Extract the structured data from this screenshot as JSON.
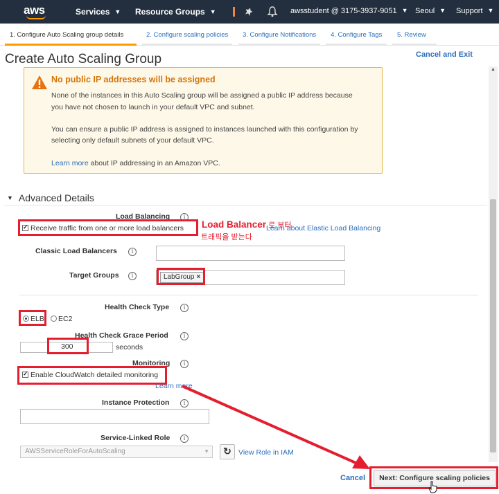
{
  "topnav": {
    "logo": "aws",
    "services": "Services",
    "resource_groups": "Resource Groups",
    "account": "awsstudent @ 3175-3937-9051",
    "region": "Seoul",
    "support": "Support",
    "icons": [
      "pin-icon",
      "bell-icon"
    ]
  },
  "steps": [
    {
      "label": "1. Configure Auto Scaling group details",
      "active": true
    },
    {
      "label": "2. Configure scaling policies",
      "active": false
    },
    {
      "label": "3. Configure Notifications",
      "active": false
    },
    {
      "label": "4. Configure Tags",
      "active": false
    },
    {
      "label": "5. Review",
      "active": false
    }
  ],
  "page": {
    "title": "Create Auto Scaling Group",
    "cancel_and_exit": "Cancel and Exit"
  },
  "warning": {
    "title": "No public IP addresses will be assigned",
    "para1_line1": "None of the instances in this Auto Scaling group will be assigned a public IP address because",
    "para1_line2": "you have not chosen to launch in your default VPC and subnet.",
    "para2_line1": "You can ensure a public IP address is assigned to instances launched with this configuration by",
    "para2_line2": "selecting only default subnets of your default VPC.",
    "learn_more": "Learn more",
    "learn_more_suffix": "about IP addressing in an Amazon VPC."
  },
  "advanced": {
    "section_title": "Advanced Details",
    "load_balancing": {
      "label": "Load Balancing",
      "checkbox_label": "Receive traffic from one or more load balancers",
      "checked": true,
      "learn_link": "Learn about Elastic Load Balancing"
    },
    "classic_lb": {
      "label": "Classic Load Balancers",
      "value": ""
    },
    "target_groups": {
      "label": "Target Groups",
      "tags": [
        "LabGroup"
      ],
      "remove_glyph": "×"
    },
    "health_check_type": {
      "label": "Health Check Type",
      "options": [
        "ELB",
        "EC2"
      ],
      "selected": "ELB"
    },
    "grace_period": {
      "label": "Health Check Grace Period",
      "value": "300",
      "unit": "seconds"
    },
    "monitoring": {
      "label": "Monitoring",
      "checkbox_label": "Enable CloudWatch detailed monitoring",
      "checked": true,
      "learn_more": "Learn more"
    },
    "instance_protection": {
      "label": "Instance Protection",
      "value": ""
    },
    "service_linked_role": {
      "label": "Service-Linked Role",
      "selected": "AWSServiceRoleForAutoScaling",
      "view_role": "View Role in IAM"
    }
  },
  "annotation": {
    "title": "Load Balancer",
    "title_suffix": " 로 부터",
    "subtitle": "트래픽을 받는다",
    "color": "#e41e2e"
  },
  "footer": {
    "cancel": "Cancel",
    "next": "Next: Configure scaling policies"
  },
  "info_glyph": "i"
}
